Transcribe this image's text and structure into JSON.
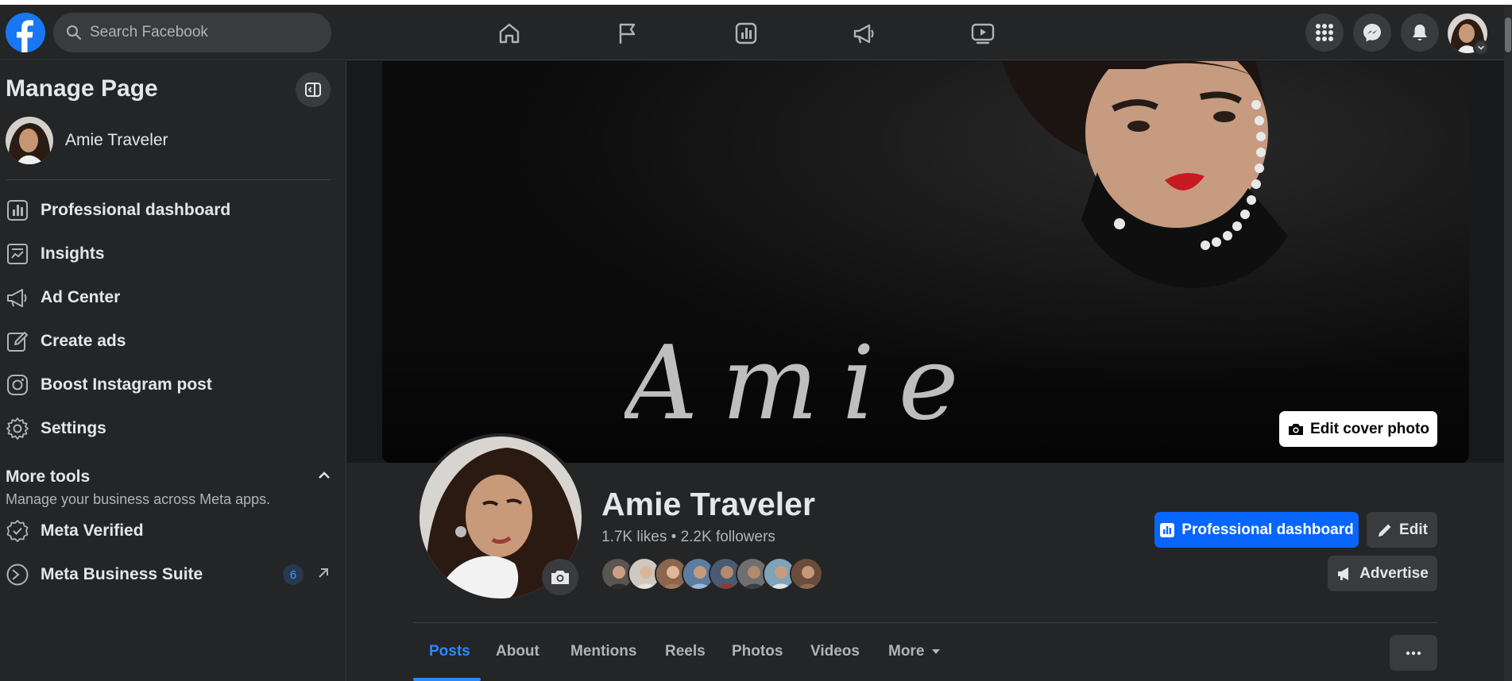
{
  "topbar": {
    "search_placeholder": "Search Facebook",
    "nav_icons": [
      "home-icon",
      "flag-icon",
      "insights-icon",
      "megaphone-icon",
      "video-icon"
    ],
    "right_icons": [
      "menu-grid-icon",
      "messenger-icon",
      "bell-icon",
      "account-avatar"
    ]
  },
  "sidebar": {
    "title": "Manage Page",
    "page_name": "Amie Traveler",
    "items": [
      {
        "label": "Professional dashboard",
        "icon": "dashboard-icon"
      },
      {
        "label": "Insights",
        "icon": "insights-icon"
      },
      {
        "label": "Ad Center",
        "icon": "megaphone-icon"
      },
      {
        "label": "Create ads",
        "icon": "pencil-icon"
      },
      {
        "label": "Boost Instagram post",
        "icon": "instagram-icon"
      },
      {
        "label": "Settings",
        "icon": "gear-icon"
      }
    ],
    "more_tools": {
      "title": "More tools",
      "subtitle": "Manage your business across Meta apps.",
      "items": [
        {
          "label": "Meta Verified",
          "icon": "verified-icon"
        },
        {
          "label": "Meta Business Suite",
          "icon": "business-suite-icon",
          "badge": "6"
        }
      ]
    }
  },
  "profile": {
    "cover_signature": "Amie",
    "edit_cover_label": "Edit cover photo",
    "name": "Amie Traveler",
    "stats": "1.7K likes • 2.2K followers",
    "professional_dashboard_label": "Professional dashboard",
    "edit_label": "Edit",
    "advertise_label": "Advertise"
  },
  "tabs": [
    {
      "label": "Posts",
      "active": true
    },
    {
      "label": "About"
    },
    {
      "label": "Mentions"
    },
    {
      "label": "Reels"
    },
    {
      "label": "Photos"
    },
    {
      "label": "Videos"
    },
    {
      "label": "More"
    }
  ],
  "colors": {
    "accent": "#0866ff",
    "link": "#2d88ff",
    "surface": "#242526",
    "background": "#18191a"
  }
}
